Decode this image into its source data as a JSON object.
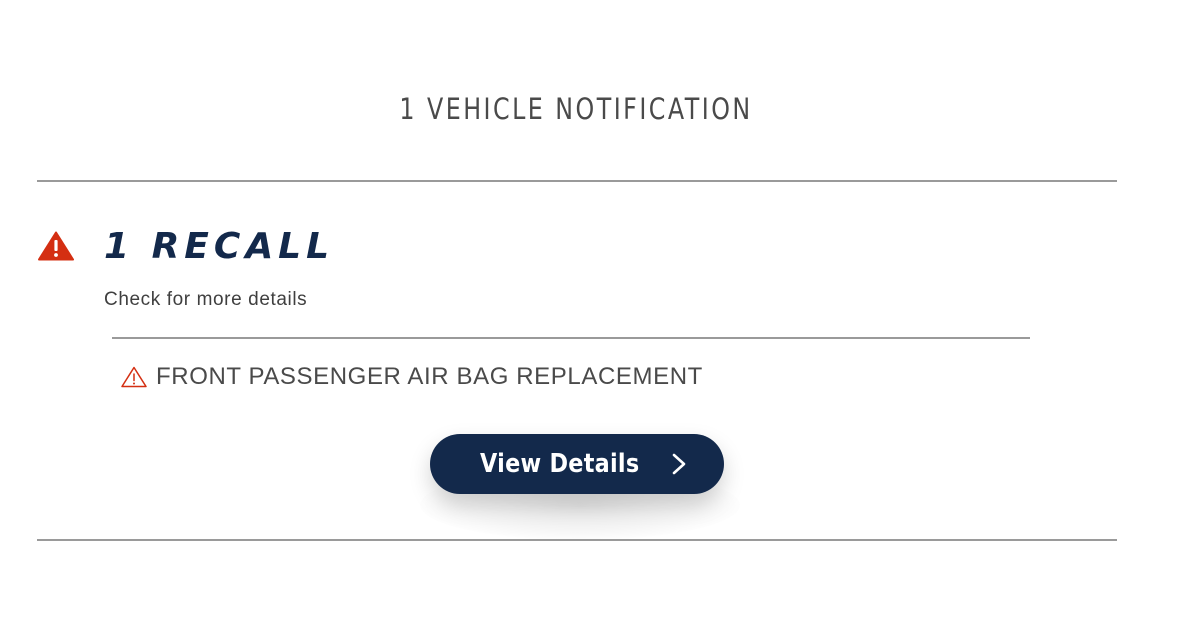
{
  "header": {
    "title": "1 VEHICLE NOTIFICATION"
  },
  "recall": {
    "heading": "1 RECALL",
    "subtitle": "Check for more details",
    "icon": "warning-triangle-filled-icon",
    "accent_color": "#d42f12",
    "items": [
      {
        "label": "FRONT PASSENGER AIR BAG REPLACEMENT",
        "icon": "warning-triangle-outline-icon"
      }
    ]
  },
  "actions": {
    "view_details_label": "View Details",
    "button_color": "#13294b"
  }
}
